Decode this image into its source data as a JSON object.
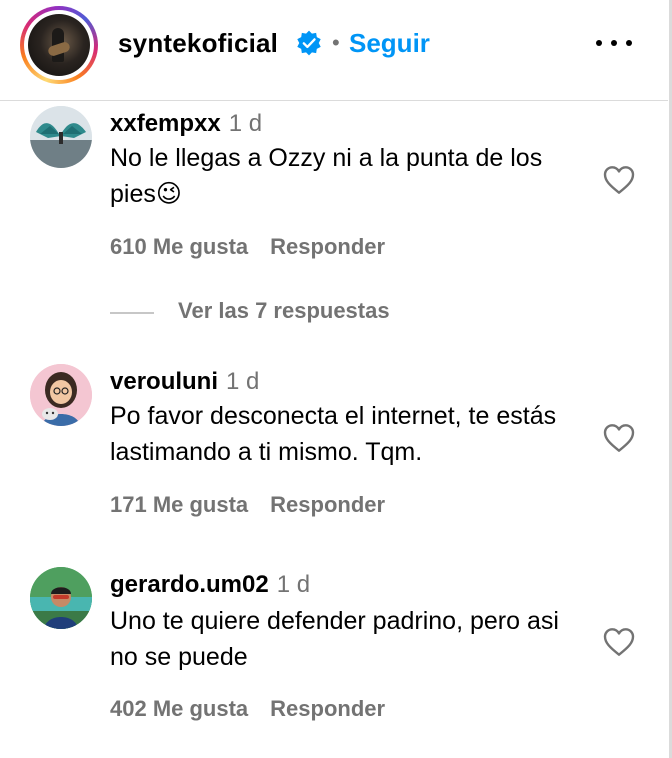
{
  "header": {
    "username": "syntekoficial",
    "separator": "•",
    "follow_label": "Seguir"
  },
  "comments": [
    {
      "username": "xxfempxx",
      "time": "1 d",
      "text": "No le llegas a Ozzy ni a la punta de los pies😉",
      "likes": "610 Me gusta",
      "reply_label": "Responder",
      "view_replies": "Ver las 7 respuestas"
    },
    {
      "username": "verouluni",
      "time": "1 d",
      "text": "Po favor desconecta el internet, te estás lastimando a ti mismo. Tqm.",
      "likes": "171 Me gusta",
      "reply_label": "Responder"
    },
    {
      "username": "gerardo.um02",
      "time": "1 d",
      "text": "Uno te quiere defender padrino, pero asi no se puede",
      "likes": "402 Me gusta",
      "reply_label": "Responder"
    }
  ],
  "colors": {
    "accent": "#0095f6",
    "muted": "#737373",
    "verified_badge": "#0095f6"
  },
  "icons": [
    "verified-badge-icon",
    "more-options-icon",
    "heart-icon"
  ]
}
